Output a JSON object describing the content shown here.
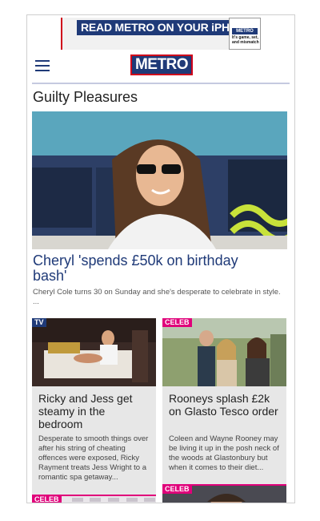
{
  "ad": {
    "text": "READ METRO ON YOUR iPHONE",
    "paper_masthead": "METRO",
    "paper_strap": "It's game, set, and mismatch"
  },
  "header": {
    "logo": "METRO",
    "section_title": "Guilty Pleasures"
  },
  "hero": {
    "headline": "Cheryl 'spends £50k on birthday bash'",
    "standfirst": "Cheryl Cole turns 30 on Sunday and she's desperate to celebrate in style. ..."
  },
  "cards": [
    {
      "tag": "TV",
      "headline": "Ricky and Jess get steamy in the bedroom",
      "blurb": "Desperate to smooth things over after his string of cheating offences were exposed, Ricky Rayment treats Jess Wright to a romantic spa getaway..."
    },
    {
      "tag": "CELEB",
      "headline": "Rooneys splash £2k on Glasto Tesco order",
      "blurb": "Coleen and Wayne Rooney may be living it up in the posh neck of the woods at Glastonbury but when it comes to their diet..."
    },
    {
      "tag": "CELEB"
    },
    {
      "tag": "CELEB"
    }
  ],
  "colors": {
    "brand_blue": "#1f3a78",
    "brand_red": "#d0021b",
    "celeb_pink": "#e0007a"
  }
}
